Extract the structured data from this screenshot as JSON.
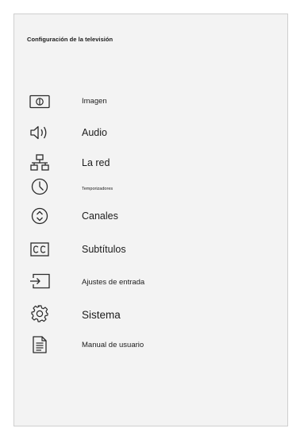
{
  "menu": {
    "title": "Configuración de la televisión",
    "items": [
      {
        "label": "Imagen",
        "icon": "picture-icon"
      },
      {
        "label": "Audio",
        "icon": "speaker-icon"
      },
      {
        "label": "La red",
        "icon": "network-icon"
      },
      {
        "label": "Temporizadores",
        "icon": "clock-icon"
      },
      {
        "label": "Canales",
        "icon": "channel-up-down-icon"
      },
      {
        "label": "Subtítulos",
        "icon": "closed-caption-icon"
      },
      {
        "label": "Ajustes de entrada",
        "icon": "input-icon"
      },
      {
        "label": "Sistema",
        "icon": "gear-icon"
      },
      {
        "label": "Manual de usuario",
        "icon": "document-icon"
      }
    ]
  },
  "colors": {
    "panel_background": "#f3f3f3",
    "panel_border": "#cfcfcf",
    "text": "#1c1c1c",
    "icon_stroke": "#2a2a2a"
  }
}
